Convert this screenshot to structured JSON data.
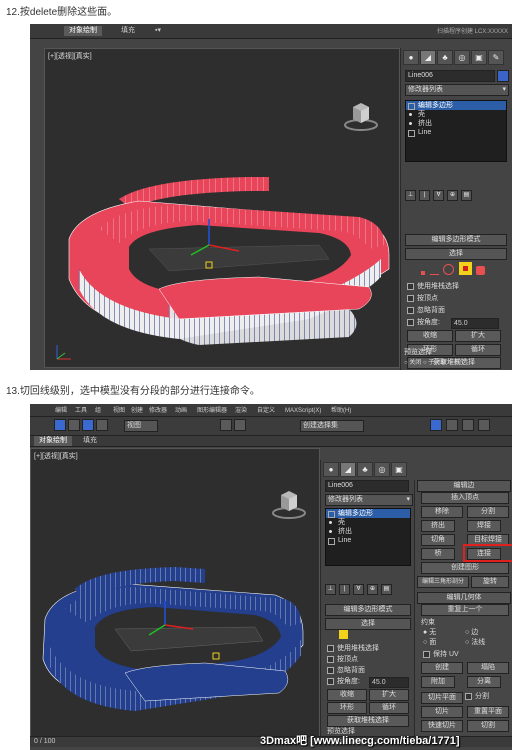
{
  "step12": {
    "caption": "12.按delete删除这些面。",
    "topbar": {
      "tabs": [
        "",
        "对象绘制",
        "填充",
        ""
      ],
      "title": "扫描程序创建 LCX:XXXXX"
    },
    "viewport_label": "[+][透视][真实]",
    "panel": {
      "object_name": "Line006",
      "modifier_list": "修改器列表",
      "stack": [
        "编辑多边形",
        "壳",
        "挤出",
        "Line"
      ],
      "rollout_title": "编辑多边形模式",
      "selection_title": "选择",
      "checks": [
        "使用堆栈选择",
        "按顶点",
        "忽略背面",
        "按角度:"
      ],
      "angle_value": "45.0",
      "buttons": [
        "收缩",
        "扩大",
        "环形",
        "循环"
      ],
      "stack_select": "获取堆栈选择",
      "preview_title": "预览选择",
      "radio": [
        "关闭",
        "子对象",
        "多个"
      ]
    }
  },
  "step13": {
    "caption": "13.切回线级别，选中模型没有分段的部分进行连接命令。",
    "topbar": {
      "tabs": [
        "对象绘制",
        "填充"
      ],
      "menu": [
        "编辑",
        "工具",
        "组",
        "视图",
        "创建",
        "修改器",
        "动画",
        "图形编辑器",
        "渲染",
        "自定义",
        "MAXScript(X)",
        "帮助(H)"
      ],
      "view_dropdown": "视图",
      "selection_set": "创建选择集"
    },
    "viewport_label": "[+][透视][真实]",
    "panel": {
      "object_name": "Line006",
      "modifier_list": "修改器列表",
      "stack": [
        "编辑多边形",
        "壳",
        "挤出",
        "Line"
      ],
      "rollout_title": "编辑多边形模式",
      "selection_title": "选择",
      "checks": [
        "使用堆栈选择",
        "按顶点",
        "忽略背面",
        "按角度:"
      ],
      "angle_value": "45.0",
      "buttons": [
        "收缩",
        "扩大",
        "环形",
        "循环"
      ],
      "stack_select": "获取堆栈选择",
      "preview_title": "预览选择"
    },
    "edit_edges": {
      "title": "编辑边",
      "insert_vertex": "插入顶点",
      "buttons": [
        "移除",
        "分割",
        "挤出",
        "焊接",
        "切角",
        "目标焊接",
        "桥",
        "连接"
      ],
      "create_shape": "创建图形",
      "edit_tri": "编辑三角形剖分",
      "rotate": "旋转",
      "geo_title": "编辑几何体",
      "repeat_last": "重复上一个",
      "constraints_title": "约束",
      "constraints": [
        "无",
        "边",
        "面",
        "法线"
      ],
      "preserve_uv": "保持 UV",
      "create": "创建",
      "collapse": "塌陷",
      "attach": "附加",
      "detach": "分离",
      "slice_plane": "切片平面",
      "split": "分割",
      "slice": "切片",
      "reset_plane": "重置平面",
      "quickslice": "快速切片",
      "cut": "切割",
      "meshsmooth": "网格平滑",
      "tessellate": "细化",
      "selection_info": "选择了 4 条边",
      "view_align": "视图对齐",
      "grid_align": "栅格对齐"
    },
    "timeline": "0 / 100",
    "watermark": "3Dmax吧  [www.linecg.com/tieba/1771]"
  },
  "colors": {
    "red_mesh": "#e8455a",
    "blue_mesh": "#233f8e",
    "select_blue": "#2c5ea8",
    "highlight": "#e02020",
    "yellow": "#f2d21a"
  }
}
